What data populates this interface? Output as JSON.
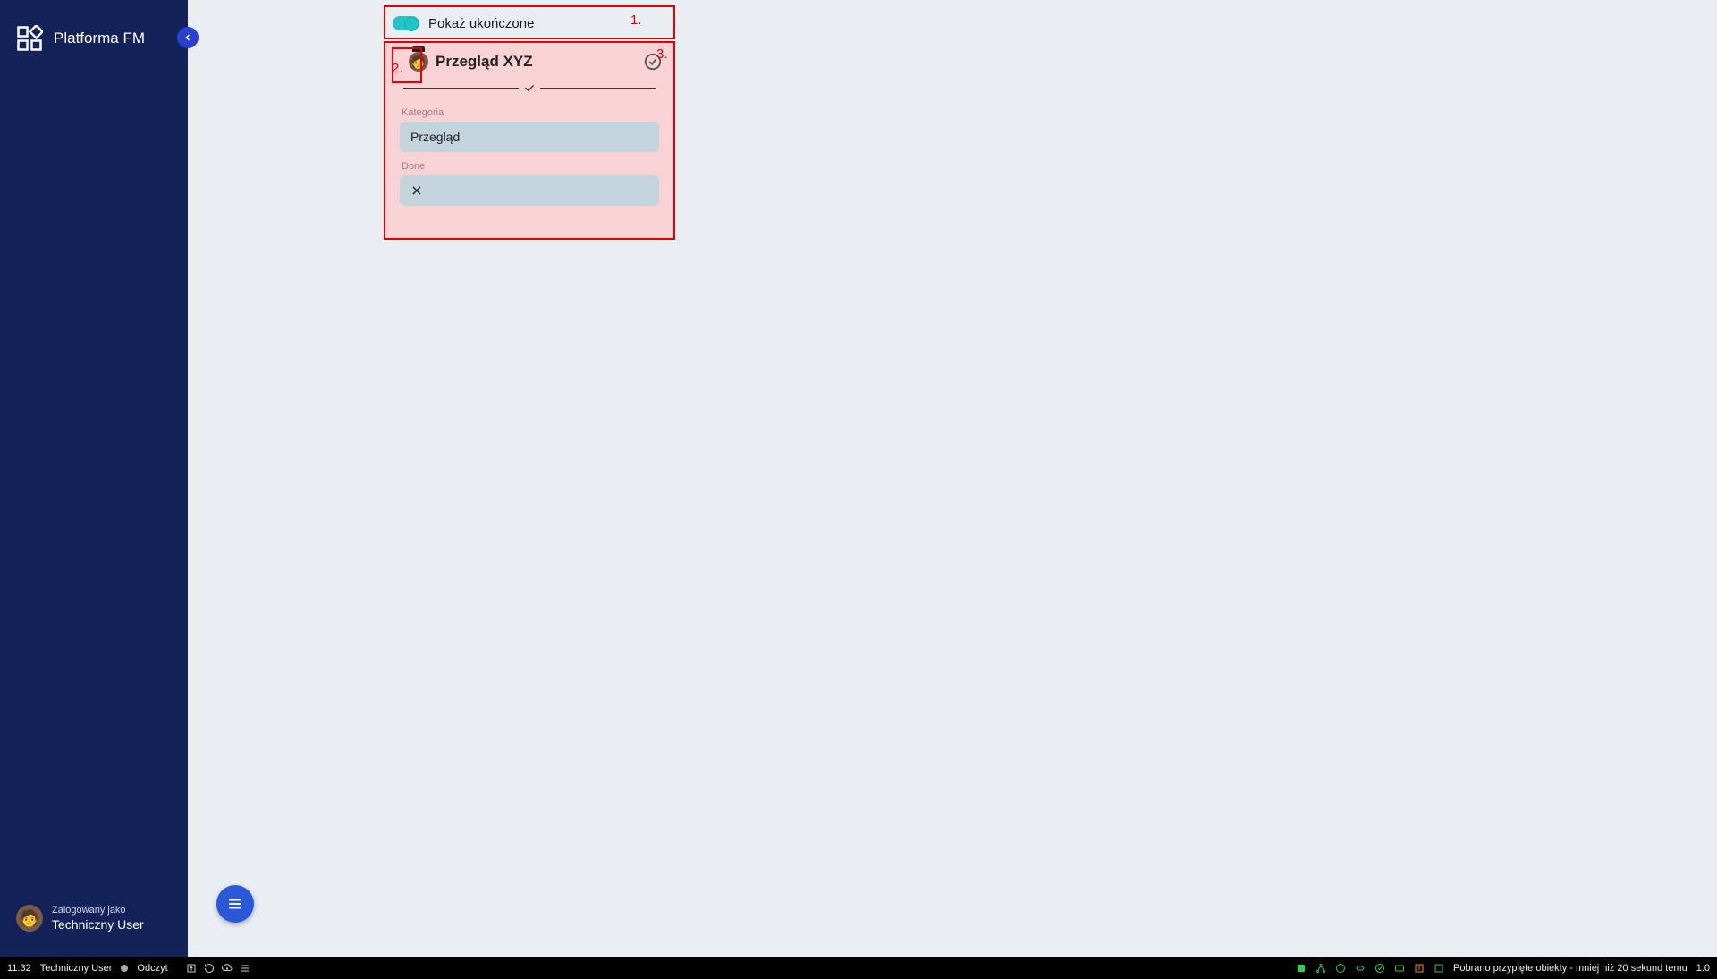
{
  "sidebar": {
    "app_title": "Platforma FM",
    "login_as_label": "Zalogowany jako",
    "user_name": "Techniczny User"
  },
  "toggle": {
    "label": "Pokaż ukończone"
  },
  "annotations": {
    "a1": "1.",
    "a2": "2.",
    "a3": "3."
  },
  "card": {
    "title": "Przegląd XYZ",
    "fields": [
      {
        "label": "Kategoria",
        "value": "Przegląd"
      },
      {
        "label": "Done",
        "value": ""
      }
    ]
  },
  "statusbar": {
    "time": "11:32",
    "user": "Techniczny User",
    "mode": "Odczyt",
    "message": "Pobrano przypięte obiekty - mniej niż 20 sekund temu",
    "version": "1.0"
  }
}
